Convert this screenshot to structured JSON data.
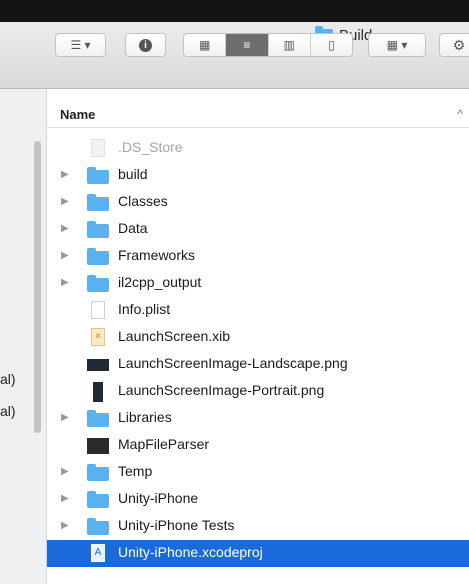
{
  "window": {
    "title": "Build"
  },
  "toolbar": {
    "arrange_icon": "list-arrange-icon",
    "info_icon": "info-icon",
    "view_icons": [
      "icon-view-icon",
      "list-view-icon",
      "column-view-icon",
      "cover-flow-icon"
    ],
    "group_icon": "group-icon",
    "action_icon": "gear-icon"
  },
  "sidebar": {
    "fragments": [
      "al)",
      "al)"
    ]
  },
  "list": {
    "column_name": "Name",
    "rows": [
      {
        "name": ".DS_Store",
        "icon": "hidden-file-icon",
        "disclosure": false,
        "dim": true,
        "selected": false
      },
      {
        "name": "build",
        "icon": "folder-icon",
        "disclosure": true,
        "dim": false,
        "selected": false
      },
      {
        "name": "Classes",
        "icon": "folder-icon",
        "disclosure": true,
        "dim": false,
        "selected": false
      },
      {
        "name": "Data",
        "icon": "folder-icon",
        "disclosure": true,
        "dim": false,
        "selected": false
      },
      {
        "name": "Frameworks",
        "icon": "folder-icon",
        "disclosure": true,
        "dim": false,
        "selected": false
      },
      {
        "name": "il2cpp_output",
        "icon": "folder-icon",
        "disclosure": true,
        "dim": false,
        "selected": false
      },
      {
        "name": "Info.plist",
        "icon": "plist-file-icon",
        "disclosure": false,
        "dim": false,
        "selected": false
      },
      {
        "name": "LaunchScreen.xib",
        "icon": "xib-file-icon",
        "disclosure": false,
        "dim": false,
        "selected": false
      },
      {
        "name": "LaunchScreenImage-Landscape.png",
        "icon": "landscape-image-icon",
        "disclosure": false,
        "dim": false,
        "selected": false
      },
      {
        "name": "LaunchScreenImage-Portrait.png",
        "icon": "portrait-image-icon",
        "disclosure": false,
        "dim": false,
        "selected": false
      },
      {
        "name": "Libraries",
        "icon": "folder-icon",
        "disclosure": true,
        "dim": false,
        "selected": false
      },
      {
        "name": "MapFileParser",
        "icon": "executable-icon",
        "disclosure": false,
        "dim": false,
        "selected": false
      },
      {
        "name": "Temp",
        "icon": "folder-icon",
        "disclosure": true,
        "dim": false,
        "selected": false
      },
      {
        "name": "Unity-iPhone",
        "icon": "folder-icon",
        "disclosure": true,
        "dim": false,
        "selected": false
      },
      {
        "name": "Unity-iPhone Tests",
        "icon": "folder-icon",
        "disclosure": true,
        "dim": false,
        "selected": false
      },
      {
        "name": "Unity-iPhone.xcodeproj",
        "icon": "xcodeproj-icon",
        "disclosure": false,
        "dim": false,
        "selected": true
      }
    ]
  },
  "colors": {
    "selection": "#1b6ad9",
    "folder": "#5ab1ef"
  }
}
